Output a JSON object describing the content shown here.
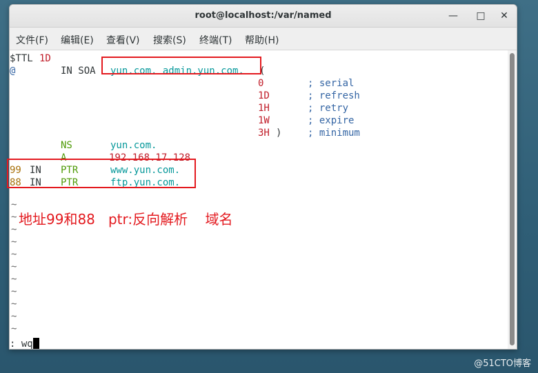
{
  "window": {
    "title": "root@localhost:/var/named",
    "minimize_glyph": "—",
    "maximize_glyph": "□",
    "close_glyph": "✕"
  },
  "menu": [
    "文件(F)",
    "编辑(E)",
    "查看(V)",
    "搜索(S)",
    "终端(T)",
    "帮助(H)"
  ],
  "zone": {
    "ttl_dollar": "$TTL",
    "ttl_value": "1D",
    "at": "@",
    "in_soa": "IN SOA",
    "soa_names": "yun.com. admin.yun.com.",
    "paren_open": "(",
    "serial_val": "0",
    "serial_label": "; serial",
    "refresh_val": "1D",
    "refresh_label": "; refresh",
    "retry_val": "1H",
    "retry_label": "; retry",
    "expire_val": "1W",
    "expire_label": "; expire",
    "minimum_val": "3H",
    "minimum_paren": ")",
    "minimum_label": "; minimum",
    "ns_type": "NS",
    "ns_value": "yun.com.",
    "a_type": "A",
    "a_value": "192.168.17.128",
    "ptr1_num": "99",
    "ptr1_in": "IN",
    "ptr1_type": "PTR",
    "ptr1_value": "www.yun.com.",
    "ptr2_num": "88",
    "ptr2_in": "IN",
    "ptr2_type": "PTR",
    "ptr2_value": "ftp.yun.com."
  },
  "tilde": "~",
  "annotation": "地址99和88   ptr:反向解析    域名",
  "command": ": wq",
  "watermark": "@51CTO博客",
  "colors": {
    "annotation": "#e3191e",
    "keyword": "#4e9a06",
    "name": "#06989a",
    "number": "#c01c28",
    "comment": "#3465a4"
  }
}
